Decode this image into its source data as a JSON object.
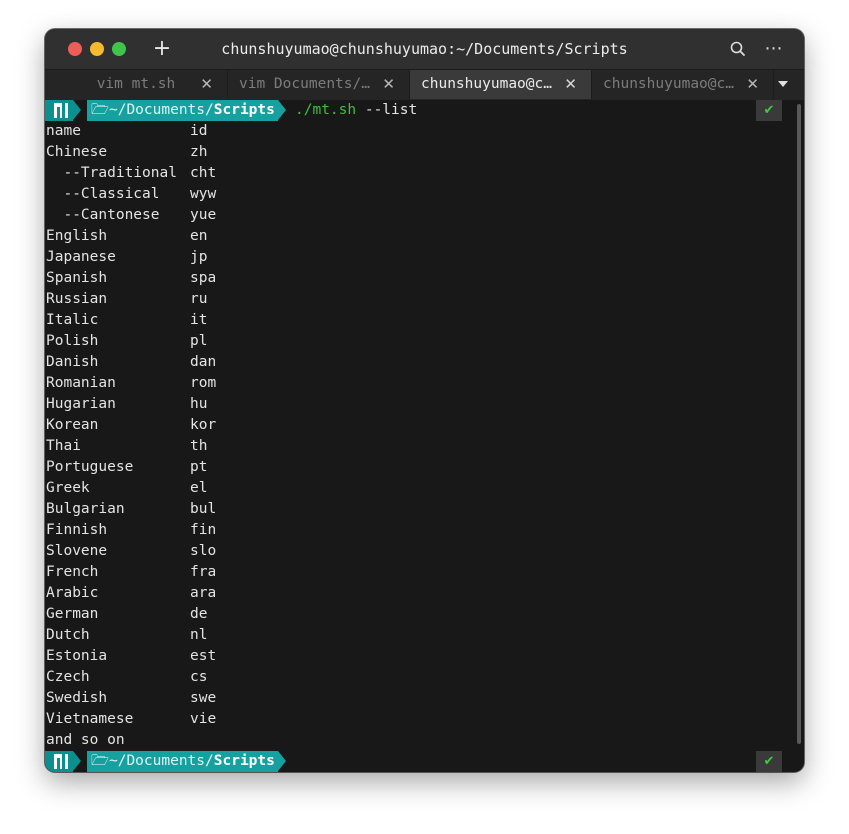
{
  "window": {
    "title": "chunshuyumao@chunshuyumao:~/Documents/Scripts",
    "new_tab": "+",
    "more": "⋯"
  },
  "tabs": [
    {
      "label": "vim mt.sh",
      "close": "✕"
    },
    {
      "label": "vim Documents/…",
      "close": "✕"
    },
    {
      "label": "chunshuyumao@c…",
      "close": "✕"
    },
    {
      "label": "chunshuyumao@c…",
      "close": "✕"
    }
  ],
  "prompt": {
    "folder_icon": "folder-open-icon",
    "path_prefix": "~/Documents/",
    "path_current": "Scripts",
    "command": "./mt.sh",
    "args": " --list",
    "status": "✔"
  },
  "output": [
    {
      "name": "name",
      "id": "id"
    },
    {
      "name": "Chinese",
      "id": "zh"
    },
    {
      "name": "  --Traditional",
      "id": "cht"
    },
    {
      "name": "  --Classical",
      "id": "wyw"
    },
    {
      "name": "  --Cantonese",
      "id": "yue"
    },
    {
      "name": "English",
      "id": "en"
    },
    {
      "name": "Japanese",
      "id": "jp"
    },
    {
      "name": "Spanish",
      "id": "spa"
    },
    {
      "name": "Russian",
      "id": "ru"
    },
    {
      "name": "Italic",
      "id": "it"
    },
    {
      "name": "Polish",
      "id": "pl"
    },
    {
      "name": "Danish",
      "id": "dan"
    },
    {
      "name": "Romanian",
      "id": "rom"
    },
    {
      "name": "Hugarian",
      "id": "hu"
    },
    {
      "name": "Korean",
      "id": "kor"
    },
    {
      "name": "Thai",
      "id": "th"
    },
    {
      "name": "Portuguese",
      "id": "pt"
    },
    {
      "name": "Greek",
      "id": "el"
    },
    {
      "name": "Bulgarian",
      "id": "bul"
    },
    {
      "name": "Finnish",
      "id": "fin"
    },
    {
      "name": "Slovene",
      "id": "slo"
    },
    {
      "name": "French",
      "id": "fra"
    },
    {
      "name": "Arabic",
      "id": "ara"
    },
    {
      "name": "German",
      "id": "de"
    },
    {
      "name": "Dutch",
      "id": "nl"
    },
    {
      "name": "Estonia",
      "id": "est"
    },
    {
      "name": "Czech",
      "id": "cs"
    },
    {
      "name": "Swedish",
      "id": "swe"
    },
    {
      "name": "Vietnamese",
      "id": "vie"
    },
    {
      "name": "and so on",
      "id": ""
    }
  ],
  "colors": {
    "prompt_logo_bg": "#0c8f8f",
    "prompt_path_bg": "#16a09f",
    "command_color": "#3fbf3f",
    "status_ok": "#3bd03b"
  }
}
